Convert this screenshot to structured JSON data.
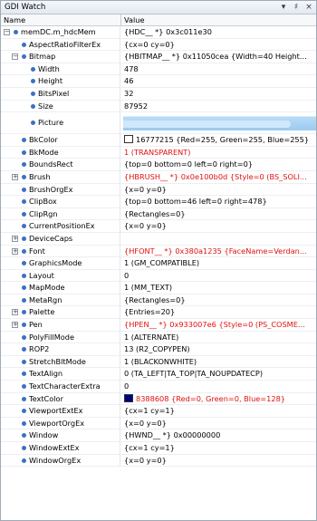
{
  "window": {
    "title": "GDI Watch",
    "dropdown_glyph": "▾",
    "pin_glyph": "♯",
    "close_glyph": "×"
  },
  "columns": {
    "name": "Name",
    "value": "Value"
  },
  "colors": {
    "red_value": "#e01010",
    "bkcolor_swatch": "#ffffff",
    "textcolor_swatch": "#000080",
    "picture_fill": "#9bcaf0"
  },
  "rows": [
    {
      "name": "memDC.m_hdcMem",
      "value": "{HDC__ *} 0x3c011e30",
      "red": false,
      "expander": "minus",
      "indent": 0
    },
    {
      "name": "AspectRatioFilterEx",
      "value": "{cx=0 cy=0}",
      "red": false,
      "expander": "none",
      "indent": 1
    },
    {
      "name": "Bitmap",
      "value": "{HBITMAP__ *} 0x11050cea {Width=40 Height...",
      "red": false,
      "expander": "minus",
      "indent": 1
    },
    {
      "name": "Width",
      "value": "478",
      "red": false,
      "expander": "none",
      "indent": 2
    },
    {
      "name": "Height",
      "value": "46",
      "red": false,
      "expander": "none",
      "indent": 2
    },
    {
      "name": "BitsPixel",
      "value": "32",
      "red": false,
      "expander": "none",
      "indent": 2
    },
    {
      "name": "Size",
      "value": "87952",
      "red": false,
      "expander": "none",
      "indent": 2
    },
    {
      "name": "Picture",
      "value": "",
      "red": false,
      "expander": "none",
      "indent": 2,
      "picture": true
    },
    {
      "name": "BkColor",
      "value": "16777215 {Red=255, Green=255, Blue=255}",
      "red": false,
      "expander": "none",
      "indent": 1,
      "swatch": "bkcolor"
    },
    {
      "name": "BkMode",
      "value": "1 (TRANSPARENT)",
      "red": true,
      "expander": "none",
      "indent": 1
    },
    {
      "name": "BoundsRect",
      "value": "{top=0 bottom=0 left=0 right=0}",
      "red": false,
      "expander": "none",
      "indent": 1
    },
    {
      "name": "Brush",
      "value": "{HBRUSH__ *} 0x0e100b0d {Style=0 (BS_SOLI...",
      "red": true,
      "expander": "plus",
      "indent": 1
    },
    {
      "name": "BrushOrgEx",
      "value": "{x=0 y=0}",
      "red": false,
      "expander": "none",
      "indent": 1
    },
    {
      "name": "ClipBox",
      "value": "{top=0 bottom=46 left=0 right=478}",
      "red": false,
      "expander": "none",
      "indent": 1
    },
    {
      "name": "ClipRgn",
      "value": "{Rectangles=0}",
      "red": false,
      "expander": "none",
      "indent": 1
    },
    {
      "name": "CurrentPositionEx",
      "value": "{x=0 y=0}",
      "red": false,
      "expander": "none",
      "indent": 1
    },
    {
      "name": "DeviceCaps",
      "value": "",
      "red": false,
      "expander": "plus",
      "indent": 1
    },
    {
      "name": "Font",
      "value": "{HFONT__ *} 0x380a1235 {FaceName=Verdan...",
      "red": true,
      "expander": "plus",
      "indent": 1
    },
    {
      "name": "GraphicsMode",
      "value": "1 (GM_COMPATIBLE)",
      "red": false,
      "expander": "none",
      "indent": 1
    },
    {
      "name": "Layout",
      "value": "0",
      "red": false,
      "expander": "none",
      "indent": 1
    },
    {
      "name": "MapMode",
      "value": "1 (MM_TEXT)",
      "red": false,
      "expander": "none",
      "indent": 1
    },
    {
      "name": "MetaRgn",
      "value": "{Rectangles=0}",
      "red": false,
      "expander": "none",
      "indent": 1
    },
    {
      "name": "Palette",
      "value": "{Entries=20}",
      "red": false,
      "expander": "plus",
      "indent": 1
    },
    {
      "name": "Pen",
      "value": "{HPEN__ *} 0x933007e6 {Style=0 (PS_COSME...",
      "red": true,
      "expander": "plus",
      "indent": 1
    },
    {
      "name": "PolyFillMode",
      "value": "1 (ALTERNATE)",
      "red": false,
      "expander": "none",
      "indent": 1
    },
    {
      "name": "ROP2",
      "value": "13 (R2_COPYPEN)",
      "red": false,
      "expander": "none",
      "indent": 1
    },
    {
      "name": "StretchBltMode",
      "value": "1 (BLACKONWHITE)",
      "red": false,
      "expander": "none",
      "indent": 1
    },
    {
      "name": "TextAlign",
      "value": "0 (TA_LEFT|TA_TOP|TA_NOUPDATECP)",
      "red": false,
      "expander": "none",
      "indent": 1
    },
    {
      "name": "TextCharacterExtra",
      "value": "0",
      "red": false,
      "expander": "none",
      "indent": 1
    },
    {
      "name": "TextColor",
      "value": "8388608 {Red=0, Green=0, Blue=128}",
      "red": true,
      "expander": "none",
      "indent": 1,
      "swatch": "textcolor"
    },
    {
      "name": "ViewportExtEx",
      "value": "{cx=1 cy=1}",
      "red": false,
      "expander": "none",
      "indent": 1
    },
    {
      "name": "ViewportOrgEx",
      "value": "{x=0 y=0}",
      "red": false,
      "expander": "none",
      "indent": 1
    },
    {
      "name": "Window",
      "value": "{HWND__ *} 0x00000000",
      "red": false,
      "expander": "none",
      "indent": 1
    },
    {
      "name": "WindowExtEx",
      "value": "{cx=1 cy=1}",
      "red": false,
      "expander": "none",
      "indent": 1
    },
    {
      "name": "WindowOrgEx",
      "value": "{x=0 y=0}",
      "red": false,
      "expander": "none",
      "indent": 1
    }
  ]
}
